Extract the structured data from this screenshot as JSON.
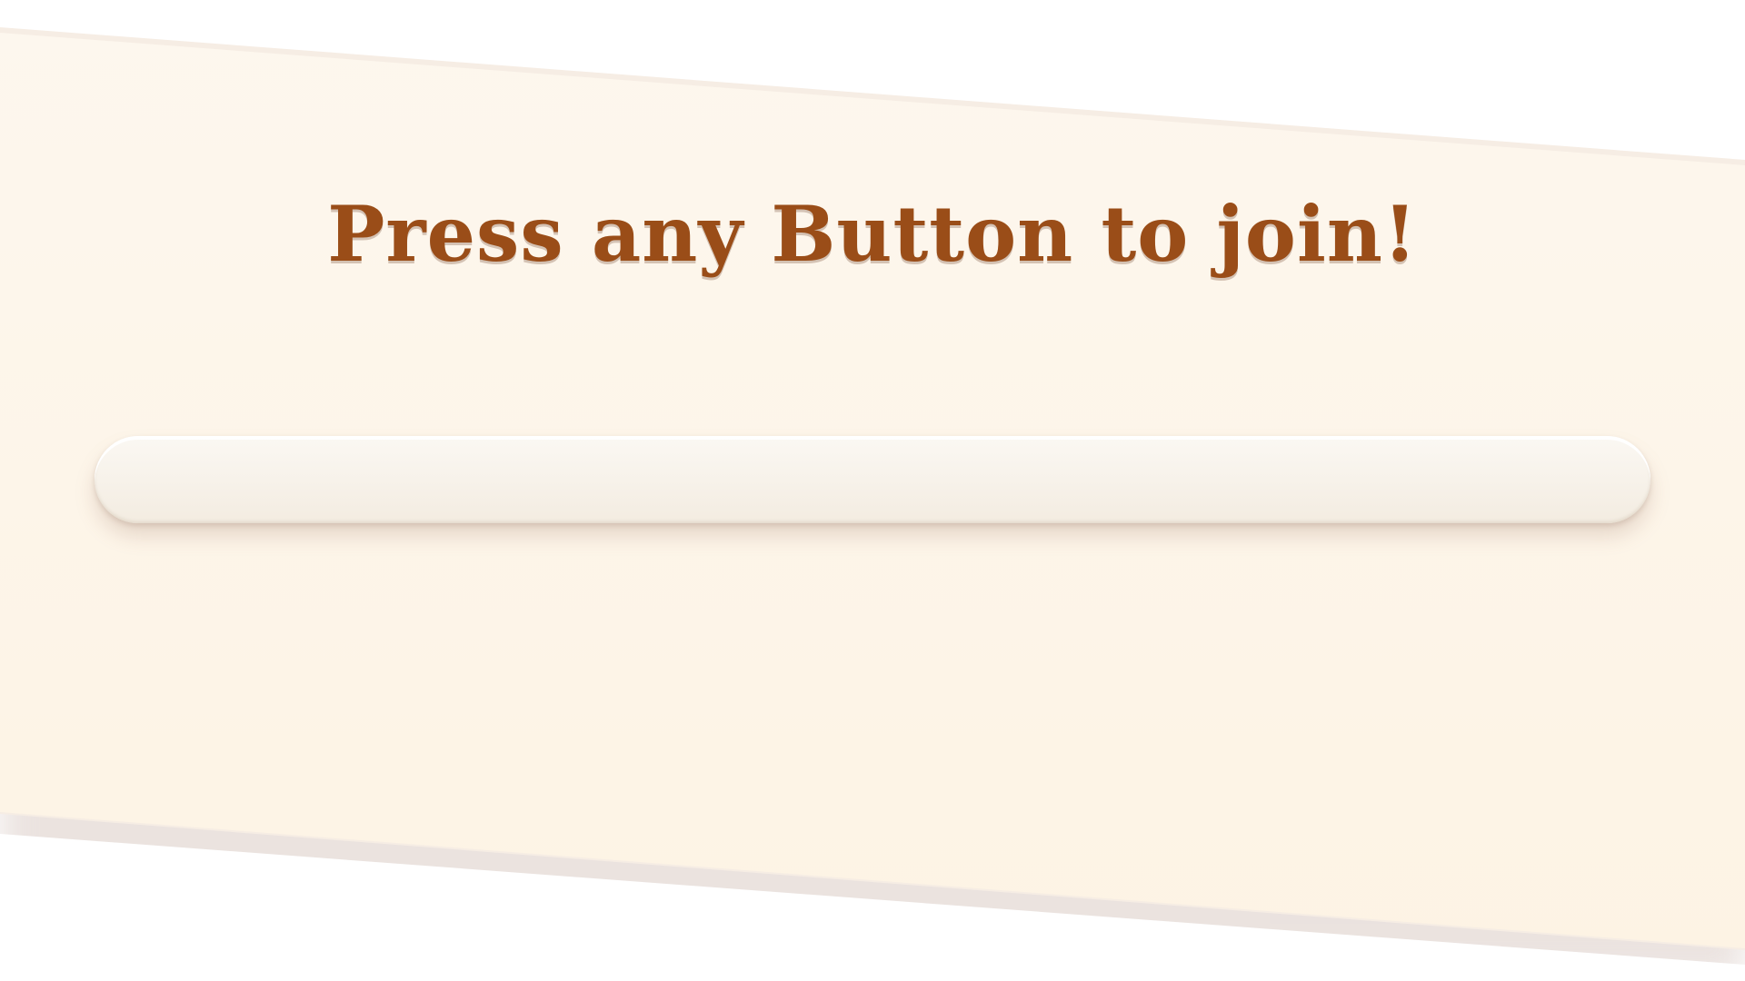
{
  "join_screen": {
    "prompt": "Press any Button to join!"
  },
  "colors": {
    "prompt_text": "#9a4d18",
    "banner": "#fdf5e9",
    "slot": "#f6f0e7",
    "background": "#ffffff"
  }
}
